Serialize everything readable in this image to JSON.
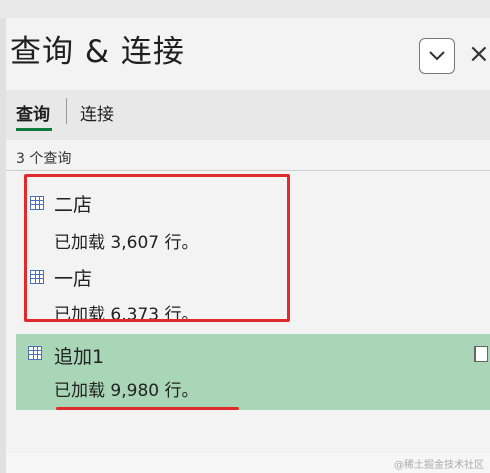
{
  "pane": {
    "title": "查询 & 连接",
    "tabs": [
      {
        "label": "查询",
        "active": true
      },
      {
        "label": "连接",
        "active": false
      }
    ],
    "query_count_label": "3 个查询",
    "close_glyph": "×"
  },
  "queries": [
    {
      "name": "二店",
      "status": "已加载 3,607 行。",
      "selected": false
    },
    {
      "name": "一店",
      "status": "已加载 6,373 行。",
      "selected": false
    },
    {
      "name": "追加1",
      "status": "已加载 9,980 行。",
      "selected": true
    }
  ],
  "icons": {
    "query": "table-icon",
    "collapse": "chevron-down-icon",
    "close": "close-icon",
    "side": "query-side-icon"
  },
  "colors": {
    "accent_green": "#107c41",
    "selected_bg": "#a9d6b7",
    "annotation_red": "#e02b2b"
  },
  "watermark": "@稀土掘金技术社区"
}
